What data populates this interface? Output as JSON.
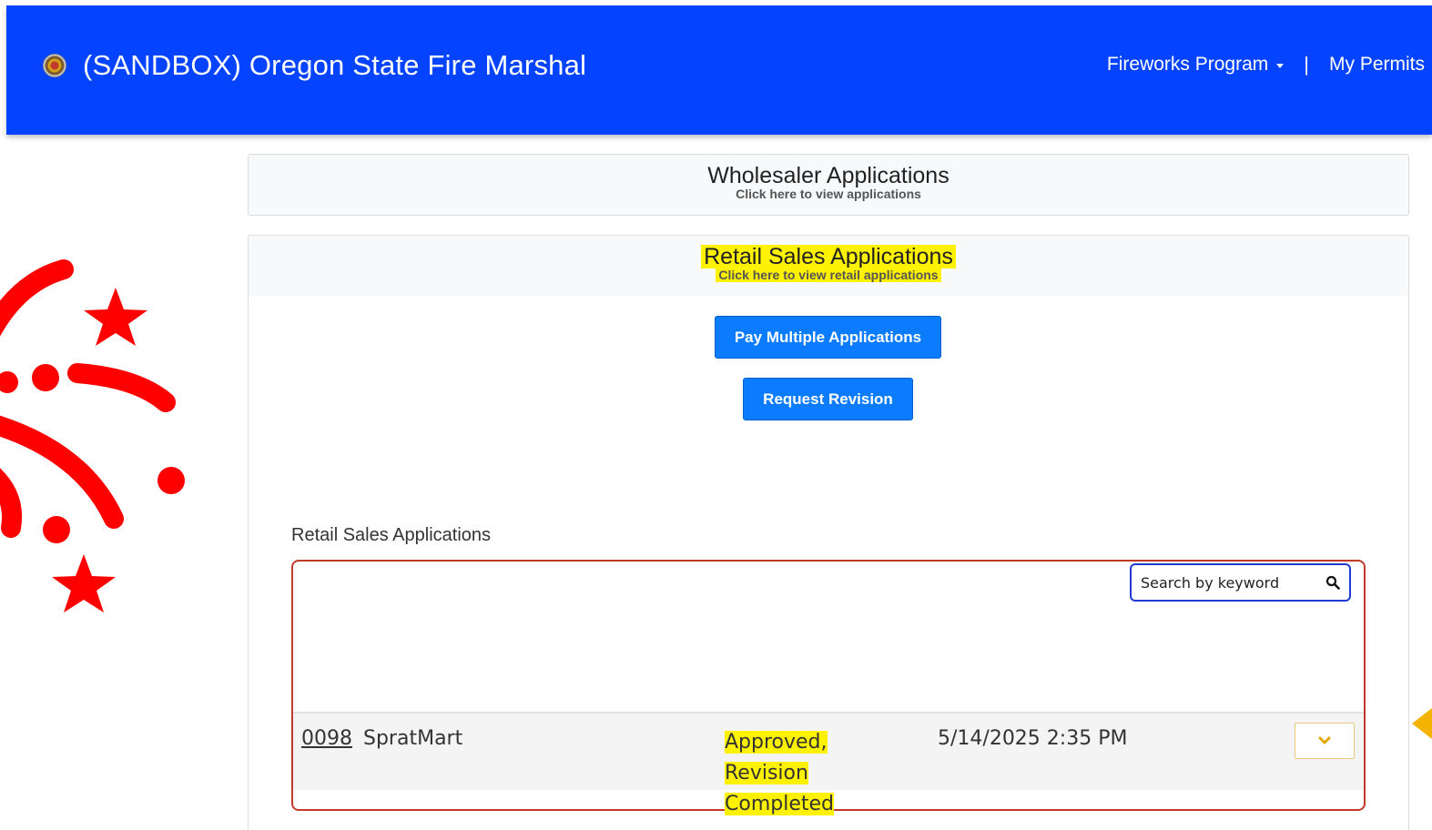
{
  "header": {
    "title": "(SANDBOX) Oregon State Fire Marshal",
    "nav": {
      "program_label": "Fireworks Program",
      "separator": "|",
      "permits_label": "My Permits"
    }
  },
  "wholesaler_panel": {
    "title": "Wholesaler Applications",
    "subtitle": "Click here to view applications"
  },
  "retail_panel": {
    "title": "Retail Sales Applications",
    "subtitle": "Click here to view retail applications",
    "pay_multiple_label": "Pay Multiple Applications",
    "request_revision_label": "Request Revision"
  },
  "retail_list": {
    "section_label": "Retail Sales Applications",
    "search_placeholder": "Search by keyword",
    "rows": [
      {
        "number": "0098",
        "name": "SpratMart",
        "status_line1": "Approved, Revision",
        "status_line2": "Completed",
        "date": "5/14/2025 2:35 PM"
      }
    ]
  },
  "colors": {
    "header_bg": "#0443ff",
    "button_bg": "#0b7bff",
    "highlight": "#fff200",
    "list_border": "#c0392b",
    "fireworks": "#ff0000"
  }
}
